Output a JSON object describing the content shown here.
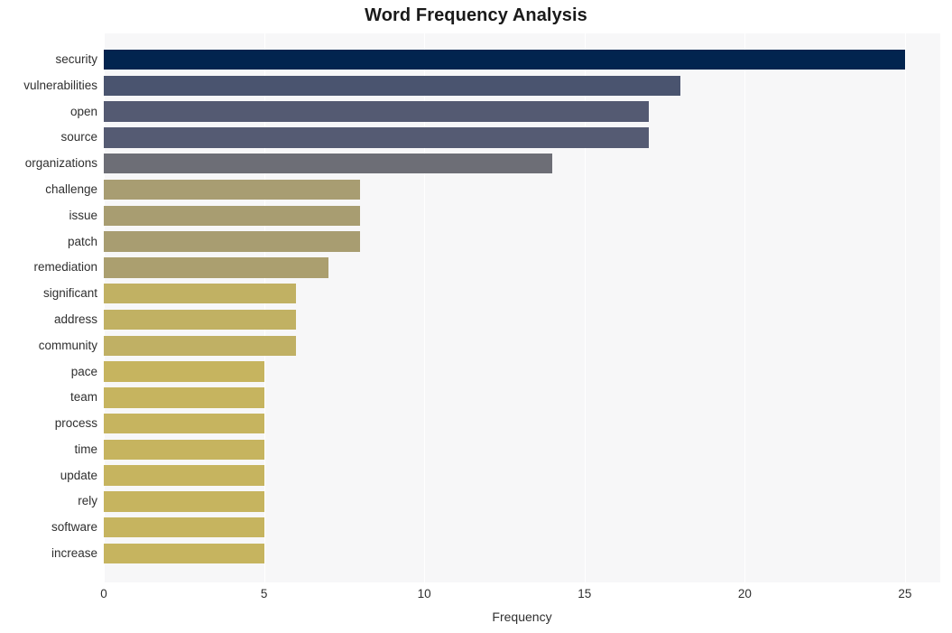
{
  "chart": {
    "title": "Word Frequency Analysis",
    "xlabel": "Frequency",
    "ylabel": ""
  },
  "chart_data": {
    "type": "bar",
    "orientation": "horizontal",
    "title": "Word Frequency Analysis",
    "xlabel": "Frequency",
    "ylabel": "",
    "xlim": [
      0,
      26.1
    ],
    "xticks": [
      0,
      5,
      10,
      15,
      20,
      25
    ],
    "xtick_labels": [
      "0",
      "5",
      "10",
      "15",
      "20",
      "25"
    ],
    "grid": "vertical-white-on-light-gray",
    "legend": "none",
    "categories": [
      "security",
      "vulnerabilities",
      "open",
      "source",
      "organizations",
      "challenge",
      "issue",
      "patch",
      "remediation",
      "significant",
      "address",
      "community",
      "pace",
      "team",
      "process",
      "time",
      "update",
      "rely",
      "software",
      "increase"
    ],
    "values": [
      25,
      18,
      17,
      17,
      14,
      8,
      8,
      8,
      7,
      6,
      6,
      6,
      5,
      5,
      5,
      5,
      5,
      5,
      5,
      5
    ],
    "bar_colors": [
      "#02244f",
      "#4a546f",
      "#545a72",
      "#555b73",
      "#6d6e76",
      "#a89d72",
      "#a89d71",
      "#a89d71",
      "#ab9f6f",
      "#c1b163",
      "#c1b163",
      "#c0b064",
      "#c6b45f",
      "#c6b45f",
      "#c6b45f",
      "#c6b45f",
      "#c6b45f",
      "#c6b45f",
      "#c6b45f",
      "#c6b45f"
    ],
    "palette": "cividis-like (dark navy to khaki gold)",
    "background": "#f7f7f8",
    "gridline_color": "#ffffff"
  }
}
